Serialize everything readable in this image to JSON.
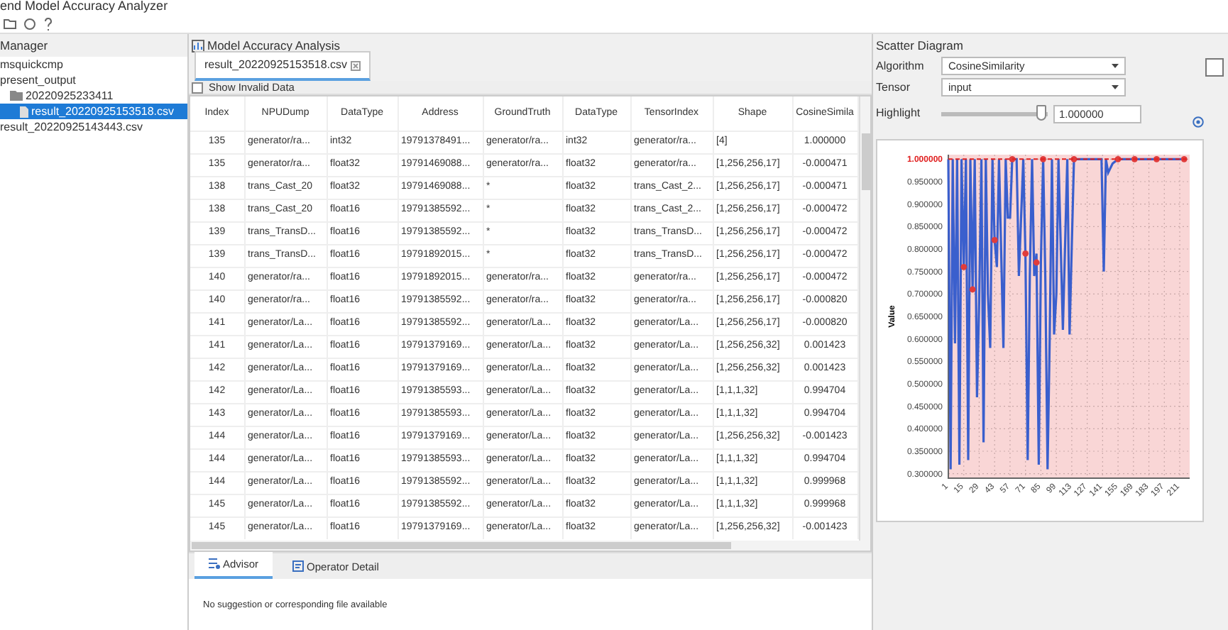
{
  "window": {
    "title": "end Model Accuracy Analyzer"
  },
  "manager": {
    "title": "Manager",
    "items": [
      {
        "label": "msquickcmp",
        "selected": false
      },
      {
        "label": "present_output",
        "selected": false,
        "children": [
          {
            "label": "20220925233411",
            "kind": "folder",
            "selected": false,
            "children": [
              {
                "label": "result_20220925153518.csv",
                "kind": "file",
                "selected": true
              }
            ]
          }
        ]
      },
      {
        "label": "result_20220925143443.csv",
        "selected": false
      }
    ]
  },
  "analysis": {
    "title": "Model Accuracy Analysis",
    "tabs": [
      {
        "label": "result_20220925153518.csv",
        "selected": true
      }
    ],
    "show_invalid": {
      "label": "Show Invalid Data",
      "checked": false
    },
    "table": {
      "columns": [
        "Index",
        "NPUDump",
        "DataType",
        "Address",
        "GroundTruth",
        "DataType",
        "TensorIndex",
        "Shape",
        "CosineSimila"
      ],
      "rows": [
        [
          "135",
          "generator/ra...",
          "int32",
          "19791378491...",
          "generator/ra...",
          "int32",
          "generator/ra...",
          "[4]",
          "1.000000"
        ],
        [
          "135",
          "generator/ra...",
          "float32",
          "19791469088...",
          "generator/ra...",
          "float32",
          "generator/ra...",
          "[1,256,256,17]",
          "-0.000471"
        ],
        [
          "138",
          "trans_Cast_20",
          "float32",
          "19791469088...",
          "*",
          "float32",
          "trans_Cast_2...",
          "[1,256,256,17]",
          "-0.000471"
        ],
        [
          "138",
          "trans_Cast_20",
          "float16",
          "19791385592...",
          "*",
          "float32",
          "trans_Cast_2...",
          "[1,256,256,17]",
          "-0.000472"
        ],
        [
          "139",
          "trans_TransD...",
          "float16",
          "19791385592...",
          "*",
          "float32",
          "trans_TransD...",
          "[1,256,256,17]",
          "-0.000472"
        ],
        [
          "139",
          "trans_TransD...",
          "float16",
          "19791892015...",
          "*",
          "float32",
          "trans_TransD...",
          "[1,256,256,17]",
          "-0.000472"
        ],
        [
          "140",
          "generator/ra...",
          "float16",
          "19791892015...",
          "generator/ra...",
          "float32",
          "generator/ra...",
          "[1,256,256,17]",
          "-0.000472"
        ],
        [
          "140",
          "generator/ra...",
          "float16",
          "19791385592...",
          "generator/ra...",
          "float32",
          "generator/ra...",
          "[1,256,256,17]",
          "-0.000820"
        ],
        [
          "141",
          "generator/La...",
          "float16",
          "19791385592...",
          "generator/La...",
          "float32",
          "generator/La...",
          "[1,256,256,17]",
          "-0.000820"
        ],
        [
          "141",
          "generator/La...",
          "float16",
          "19791379169...",
          "generator/La...",
          "float32",
          "generator/La...",
          "[1,256,256,32]",
          "0.001423"
        ],
        [
          "142",
          "generator/La...",
          "float16",
          "19791379169...",
          "generator/La...",
          "float32",
          "generator/La...",
          "[1,256,256,32]",
          "0.001423"
        ],
        [
          "142",
          "generator/La...",
          "float16",
          "19791385593...",
          "generator/La...",
          "float32",
          "generator/La...",
          "[1,1,1,32]",
          "0.994704"
        ],
        [
          "143",
          "generator/La...",
          "float16",
          "19791385593...",
          "generator/La...",
          "float32",
          "generator/La...",
          "[1,1,1,32]",
          "0.994704"
        ],
        [
          "144",
          "generator/La...",
          "float16",
          "19791379169...",
          "generator/La...",
          "float32",
          "generator/La...",
          "[1,256,256,32]",
          "-0.001423"
        ],
        [
          "144",
          "generator/La...",
          "float16",
          "19791385593...",
          "generator/La...",
          "float32",
          "generator/La...",
          "[1,1,1,32]",
          "0.994704"
        ],
        [
          "144",
          "generator/La...",
          "float16",
          "19791385592...",
          "generator/La...",
          "float32",
          "generator/La...",
          "[1,1,1,32]",
          "0.999968"
        ],
        [
          "145",
          "generator/La...",
          "float16",
          "19791385592...",
          "generator/La...",
          "float32",
          "generator/La...",
          "[1,1,1,32]",
          "0.999968"
        ],
        [
          "145",
          "generator/La...",
          "float16",
          "19791379169...",
          "generator/La...",
          "float32",
          "generator/La...",
          "[1,256,256,32]",
          "-0.001423"
        ]
      ]
    },
    "bottom_tabs": [
      {
        "label": "Advisor",
        "kind": "advisor",
        "selected": true
      },
      {
        "label": "Operator Detail",
        "kind": "detail",
        "selected": false
      }
    ],
    "message": "No suggestion or corresponding file available"
  },
  "scatter": {
    "title": "Scatter Diagram",
    "algorithm": {
      "label": "Algorithm",
      "value": "CosineSimilarity"
    },
    "tensor": {
      "label": "Tensor",
      "value": "input"
    },
    "highlight": {
      "label": "Highlight",
      "level": 0.95,
      "value": "1.000000"
    },
    "chart_data": {
      "type": "line",
      "ylabel": "Value",
      "grid": true,
      "xlim": [
        1,
        220
      ],
      "ylim": [
        0.29,
        1.01
      ],
      "x": [
        1,
        3,
        5,
        7,
        9,
        11,
        13,
        15,
        17,
        19,
        21,
        23,
        25,
        27,
        29,
        31,
        33,
        35,
        37,
        39,
        41,
        43,
        45,
        47,
        51,
        53,
        55,
        57,
        59,
        63,
        65,
        69,
        71,
        73,
        75,
        77,
        79,
        81,
        83,
        85,
        87,
        89,
        91,
        93,
        95,
        97,
        99,
        101,
        105,
        109,
        111,
        113,
        115,
        127,
        140,
        142,
        144,
        146,
        150,
        155,
        170,
        190,
        215
      ],
      "series": [
        {
          "color": "#3a5fcd",
          "values": [
            1.0,
            0.31,
            1.0,
            0.59,
            1.0,
            0.32,
            1.0,
            0.76,
            1.0,
            0.33,
            1.0,
            0.71,
            1.0,
            0.47,
            0.68,
            1.0,
            0.37,
            1.0,
            0.7,
            0.58,
            1.0,
            0.82,
            0.76,
            1.0,
            0.58,
            1.0,
            0.87,
            0.87,
            1.0,
            1.0,
            0.74,
            1.0,
            0.79,
            0.33,
            0.74,
            1.0,
            0.74,
            0.79,
            0.32,
            0.77,
            1.0,
            0.74,
            0.31,
            0.6,
            1.0,
            0.61,
            0.7,
            1.0,
            0.62,
            1.0,
            0.61,
            0.8,
            1.0,
            1.0,
            1.0,
            0.75,
            1.0,
            0.97,
            0.99,
            1.0,
            1.0,
            1.0,
            1.0
          ]
        },
        {
          "type": "scatter",
          "color": "#e03c3c",
          "values": [
            null,
            null,
            null,
            null,
            null,
            null,
            null,
            0.76,
            null,
            null,
            null,
            0.71,
            null,
            null,
            null,
            null,
            null,
            null,
            null,
            null,
            null,
            0.82,
            null,
            null,
            null,
            null,
            null,
            null,
            1.0,
            null,
            null,
            null,
            0.79,
            null,
            null,
            null,
            null,
            0.77,
            null,
            null,
            1.0,
            null,
            null,
            null,
            null,
            null,
            null,
            null,
            null,
            null,
            null,
            null,
            1.0,
            null,
            null,
            null,
            null,
            null,
            null,
            1.0,
            1.0,
            1.0,
            1.0
          ]
        }
      ],
      "xticks": [
        1,
        15,
        29,
        43,
        57,
        71,
        85,
        99,
        113,
        127,
        141,
        155,
        169,
        183,
        197,
        211
      ],
      "yticks": [
        {
          "value": 0.3,
          "label": "0.300000"
        },
        {
          "value": 0.35,
          "label": "0.350000"
        },
        {
          "value": 0.4,
          "label": "0.400000"
        },
        {
          "value": 0.45,
          "label": "0.450000"
        },
        {
          "value": 0.5,
          "label": "0.500000"
        },
        {
          "value": 0.55,
          "label": "0.550000"
        },
        {
          "value": 0.6,
          "label": "0.600000"
        },
        {
          "value": 0.65,
          "label": "0.650000"
        },
        {
          "value": 0.7,
          "label": "0.700000"
        },
        {
          "value": 0.75,
          "label": "0.750000"
        },
        {
          "value": 0.8,
          "label": "0.800000"
        },
        {
          "value": 0.85,
          "label": "0.850000"
        },
        {
          "value": 0.9,
          "label": "0.900000"
        },
        {
          "value": 0.95,
          "label": "0.950000"
        },
        {
          "value": 1.0,
          "label": "1.000000"
        }
      ],
      "ref_lines": [
        {
          "axis": "y",
          "value": 1.0,
          "color": "#e02020"
        }
      ]
    }
  }
}
